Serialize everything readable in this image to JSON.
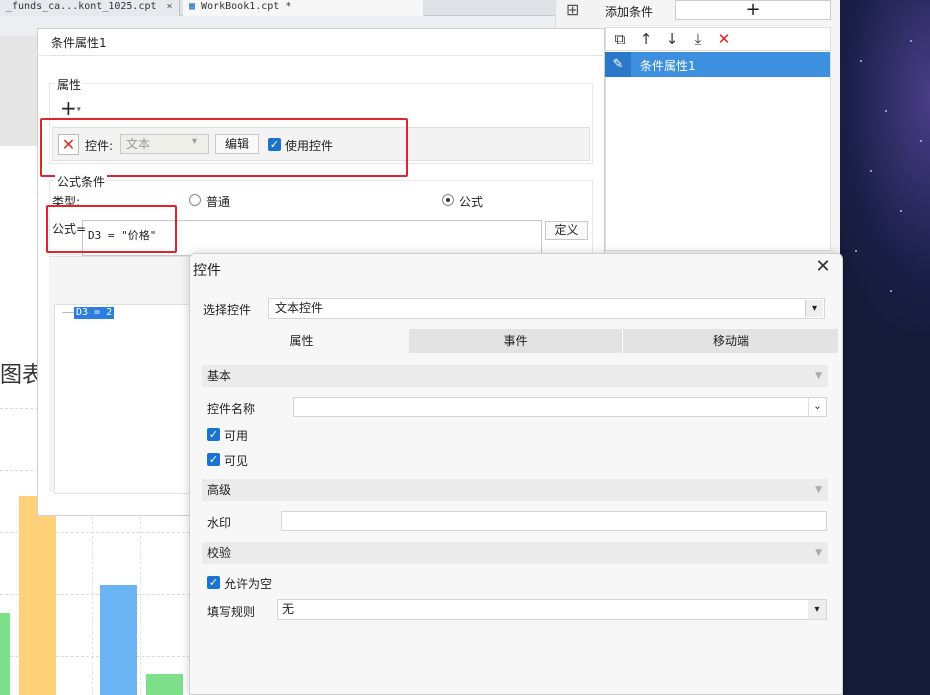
{
  "background": {
    "tabs": [
      {
        "label": "_funds_ca...kont_1025.cpt",
        "close": "×"
      },
      {
        "label": "WorkBook1.cpt *",
        "close": ""
      }
    ],
    "chart_title_fragment": "图表",
    "bar_colors": [
      "#7ee08a",
      "#ffd27a",
      "#6ab4f4",
      "#7ee08a"
    ]
  },
  "right_panel": {
    "add_condition_label": "添加条件",
    "add_icon": "+",
    "toolbar_icons": [
      "copy-icon",
      "arrow-up-icon",
      "arrow-down-icon",
      "move-bottom-icon",
      "delete-icon"
    ],
    "items": [
      {
        "label": "条件属性1",
        "icon": "edit-icon"
      }
    ]
  },
  "cond_dialog": {
    "title": "条件属性1",
    "attr_group_label": "属性",
    "plus_icon": "+",
    "control_label": "控件:",
    "control_select_value": "文本",
    "edit_button": "编辑",
    "use_control_label": "使用控件",
    "use_control_checked": true,
    "formula_group_label": "公式条件",
    "type_label": "类型:",
    "radio_normal": "普通",
    "radio_formula": "公式",
    "formula_label": "公式=",
    "formula_value": "D3 = \"价格\"",
    "define_button": "定义",
    "tree_item": "D3 = 2"
  },
  "widget_dialog": {
    "title": "控件",
    "close_icon": "✕",
    "select_label": "选择控件",
    "select_value": "文本控件",
    "tabs": [
      "属性",
      "事件",
      "移动端"
    ],
    "active_tab": 0,
    "section_basic": "基本",
    "name_label": "控件名称",
    "name_value": "",
    "enabled_label": "可用",
    "enabled_checked": true,
    "visible_label": "可见",
    "visible_checked": true,
    "section_advanced": "高级",
    "watermark_label": "水印",
    "watermark_value": "",
    "section_verify": "校验",
    "allow_empty_label": "允许为空",
    "allow_empty_checked": true,
    "rule_label": "填写规则",
    "rule_value": "无"
  },
  "colors": {
    "accent": "#1a72d1",
    "selection": "#3d8fe0",
    "highlight_box": "#e0242b"
  }
}
